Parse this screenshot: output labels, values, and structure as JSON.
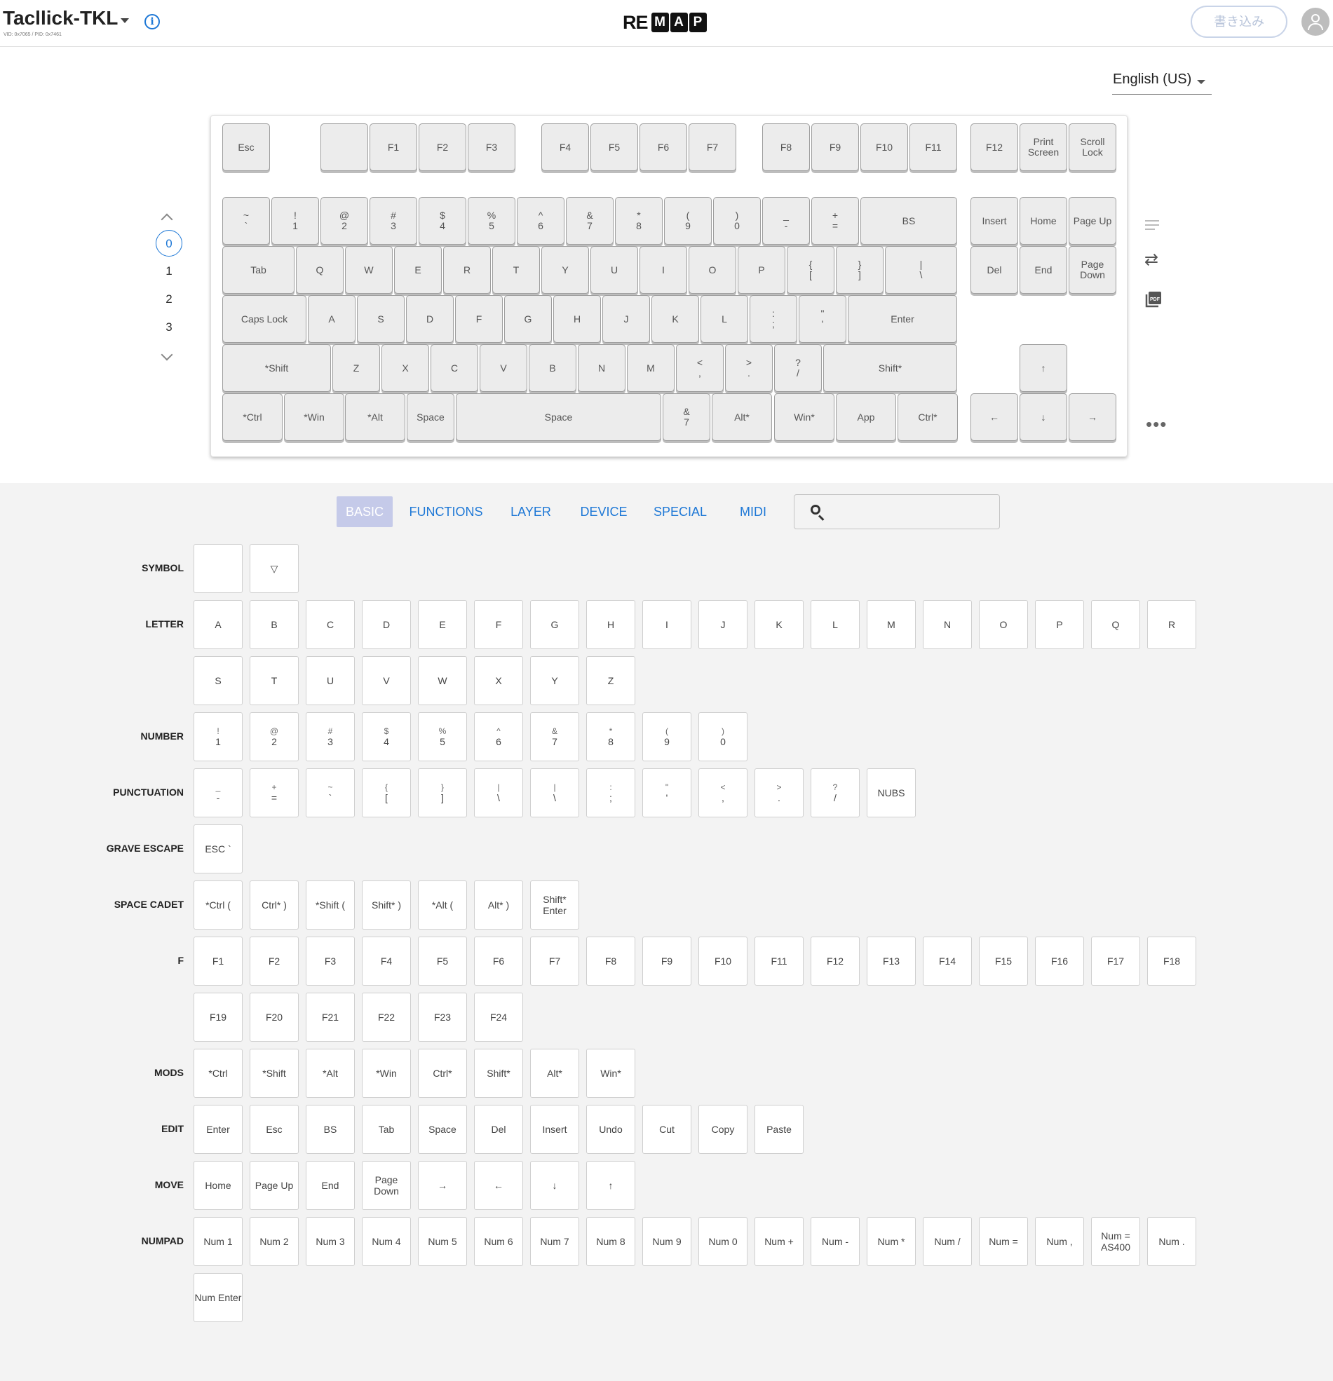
{
  "header": {
    "keyboard_name": "Tacllick-TKL",
    "ids": "VID: 0x7065 / PID: 0x7461",
    "logo_re": "RE",
    "logo_letters": [
      "M",
      "A",
      "P"
    ],
    "write_button": "書き込み"
  },
  "language": {
    "selected": "English (US)"
  },
  "layers": {
    "items": [
      "0",
      "1",
      "2",
      "3"
    ],
    "active": 0
  },
  "keyboard": {
    "rows": [
      [
        {
          "l": "Esc"
        },
        {
          "l": ""
        },
        {
          "l": "F1"
        },
        {
          "l": "F2"
        },
        {
          "l": "F3"
        },
        {
          "l": "F4"
        },
        {
          "l": "F5"
        },
        {
          "l": "F6"
        },
        {
          "l": "F7"
        },
        {
          "l": "F8"
        },
        {
          "l": "F9"
        },
        {
          "l": "F10"
        },
        {
          "l": "F11"
        },
        {
          "l": "F12"
        },
        {
          "l": "Print Screen"
        },
        {
          "l": "Scroll Lock"
        }
      ],
      [
        {
          "t": "~",
          "l": "`"
        },
        {
          "t": "!",
          "l": "1"
        },
        {
          "t": "@",
          "l": "2"
        },
        {
          "t": "#",
          "l": "3"
        },
        {
          "t": "$",
          "l": "4"
        },
        {
          "t": "%",
          "l": "5"
        },
        {
          "t": "^",
          "l": "6"
        },
        {
          "t": "&",
          "l": "7"
        },
        {
          "t": "*",
          "l": "8"
        },
        {
          "t": "(",
          "l": "9"
        },
        {
          "t": ")",
          "l": "0"
        },
        {
          "t": "_",
          "l": "-"
        },
        {
          "t": "+",
          "l": "="
        },
        {
          "l": "BS"
        },
        {
          "l": "Insert"
        },
        {
          "l": "Home"
        },
        {
          "l": "Page Up"
        }
      ],
      [
        {
          "l": "Tab"
        },
        {
          "l": "Q"
        },
        {
          "l": "W"
        },
        {
          "l": "E"
        },
        {
          "l": "R"
        },
        {
          "l": "T"
        },
        {
          "l": "Y"
        },
        {
          "l": "U"
        },
        {
          "l": "I"
        },
        {
          "l": "O"
        },
        {
          "l": "P"
        },
        {
          "t": "{",
          "l": "["
        },
        {
          "t": "}",
          "l": "]"
        },
        {
          "t": "|",
          "l": "\\"
        },
        {
          "l": "Del"
        },
        {
          "l": "End"
        },
        {
          "l": "Page Down"
        }
      ],
      [
        {
          "l": "Caps Lock"
        },
        {
          "l": "A"
        },
        {
          "l": "S"
        },
        {
          "l": "D"
        },
        {
          "l": "F"
        },
        {
          "l": "G"
        },
        {
          "l": "H"
        },
        {
          "l": "J"
        },
        {
          "l": "K"
        },
        {
          "l": "L"
        },
        {
          "t": ":",
          "l": ";"
        },
        {
          "t": "\"",
          "l": "'"
        },
        {
          "l": "Enter"
        }
      ],
      [
        {
          "l": "*Shift"
        },
        {
          "l": "Z"
        },
        {
          "l": "X"
        },
        {
          "l": "C"
        },
        {
          "l": "V"
        },
        {
          "l": "B"
        },
        {
          "l": "N"
        },
        {
          "l": "M"
        },
        {
          "t": "<",
          "l": ","
        },
        {
          "t": ">",
          "l": "."
        },
        {
          "t": "?",
          "l": "/"
        },
        {
          "l": "Shift*"
        },
        {
          "l": "↑"
        }
      ],
      [
        {
          "l": "*Ctrl"
        },
        {
          "l": "*Win"
        },
        {
          "l": "*Alt"
        },
        {
          "l": "Space"
        },
        {
          "l": "Space"
        },
        {
          "t": "&",
          "l": "7"
        },
        {
          "l": "Alt*"
        },
        {
          "l": "Win*"
        },
        {
          "l": "App"
        },
        {
          "l": "Ctrl*"
        },
        {
          "l": "←"
        },
        {
          "l": "↓"
        },
        {
          "l": "→"
        }
      ]
    ]
  },
  "side_icons": [
    "lines-icon",
    "swap-icon",
    "pdf-icon",
    "more-icon"
  ],
  "tabs": [
    {
      "label": "BASIC",
      "active": true
    },
    {
      "label": "FUNCTIONS",
      "active": false
    },
    {
      "label": "LAYER",
      "active": false
    },
    {
      "label": "DEVICE",
      "active": false
    },
    {
      "label": "SPECIAL",
      "active": false
    },
    {
      "label": "MIDI",
      "active": false
    }
  ],
  "search": {
    "placeholder": ""
  },
  "palette": [
    {
      "label": "SYMBOL",
      "rows": [
        [
          {
            "l": ""
          },
          {
            "l": "▽"
          }
        ]
      ]
    },
    {
      "label": "LETTER",
      "rows": [
        [
          {
            "l": "A"
          },
          {
            "l": "B"
          },
          {
            "l": "C"
          },
          {
            "l": "D"
          },
          {
            "l": "E"
          },
          {
            "l": "F"
          },
          {
            "l": "G"
          },
          {
            "l": "H"
          },
          {
            "l": "I"
          },
          {
            "l": "J"
          },
          {
            "l": "K"
          },
          {
            "l": "L"
          },
          {
            "l": "M"
          },
          {
            "l": "N"
          },
          {
            "l": "O"
          },
          {
            "l": "P"
          },
          {
            "l": "Q"
          },
          {
            "l": "R"
          }
        ],
        [
          {
            "l": "S"
          },
          {
            "l": "T"
          },
          {
            "l": "U"
          },
          {
            "l": "V"
          },
          {
            "l": "W"
          },
          {
            "l": "X"
          },
          {
            "l": "Y"
          },
          {
            "l": "Z"
          }
        ]
      ]
    },
    {
      "label": "NUMBER",
      "rows": [
        [
          {
            "t": "!",
            "l": "1"
          },
          {
            "t": "@",
            "l": "2"
          },
          {
            "t": "#",
            "l": "3"
          },
          {
            "t": "$",
            "l": "4"
          },
          {
            "t": "%",
            "l": "5"
          },
          {
            "t": "^",
            "l": "6"
          },
          {
            "t": "&",
            "l": "7"
          },
          {
            "t": "*",
            "l": "8"
          },
          {
            "t": "(",
            "l": "9"
          },
          {
            "t": ")",
            "l": "0"
          }
        ]
      ]
    },
    {
      "label": "PUNCTUATION",
      "rows": [
        [
          {
            "t": "_",
            "l": "-"
          },
          {
            "t": "+",
            "l": "="
          },
          {
            "t": "~",
            "l": "`"
          },
          {
            "t": "{",
            "l": "["
          },
          {
            "t": "}",
            "l": "]"
          },
          {
            "t": "|",
            "l": "\\"
          },
          {
            "t": "|",
            "l": "\\"
          },
          {
            "t": ":",
            "l": ";"
          },
          {
            "t": "\"",
            "l": "'"
          },
          {
            "t": "<",
            "l": ","
          },
          {
            "t": ">",
            "l": "."
          },
          {
            "t": "?",
            "l": "/"
          },
          {
            "l": "NUBS"
          }
        ]
      ]
    },
    {
      "label": "GRAVE ESCAPE",
      "rows": [
        [
          {
            "l": "ESC `"
          }
        ]
      ]
    },
    {
      "label": "SPACE CADET",
      "rows": [
        [
          {
            "l": "*Ctrl ("
          },
          {
            "l": "Ctrl* )"
          },
          {
            "l": "*Shift ("
          },
          {
            "l": "Shift* )"
          },
          {
            "l": "*Alt ("
          },
          {
            "l": "Alt* )"
          },
          {
            "l": "Shift* Enter"
          }
        ]
      ]
    },
    {
      "label": "F",
      "rows": [
        [
          {
            "l": "F1"
          },
          {
            "l": "F2"
          },
          {
            "l": "F3"
          },
          {
            "l": "F4"
          },
          {
            "l": "F5"
          },
          {
            "l": "F6"
          },
          {
            "l": "F7"
          },
          {
            "l": "F8"
          },
          {
            "l": "F9"
          },
          {
            "l": "F10"
          },
          {
            "l": "F11"
          },
          {
            "l": "F12"
          },
          {
            "l": "F13"
          },
          {
            "l": "F14"
          },
          {
            "l": "F15"
          },
          {
            "l": "F16"
          },
          {
            "l": "F17"
          },
          {
            "l": "F18"
          }
        ],
        [
          {
            "l": "F19"
          },
          {
            "l": "F20"
          },
          {
            "l": "F21"
          },
          {
            "l": "F22"
          },
          {
            "l": "F23"
          },
          {
            "l": "F24"
          }
        ]
      ]
    },
    {
      "label": "MODS",
      "rows": [
        [
          {
            "l": "*Ctrl"
          },
          {
            "l": "*Shift"
          },
          {
            "l": "*Alt"
          },
          {
            "l": "*Win"
          },
          {
            "l": "Ctrl*"
          },
          {
            "l": "Shift*"
          },
          {
            "l": "Alt*"
          },
          {
            "l": "Win*"
          }
        ]
      ]
    },
    {
      "label": "EDIT",
      "rows": [
        [
          {
            "l": "Enter"
          },
          {
            "l": "Esc"
          },
          {
            "l": "BS"
          },
          {
            "l": "Tab"
          },
          {
            "l": "Space"
          },
          {
            "l": "Del"
          },
          {
            "l": "Insert"
          },
          {
            "l": "Undo"
          },
          {
            "l": "Cut"
          },
          {
            "l": "Copy"
          },
          {
            "l": "Paste"
          }
        ]
      ]
    },
    {
      "label": "MOVE",
      "rows": [
        [
          {
            "l": "Home"
          },
          {
            "l": "Page Up"
          },
          {
            "l": "End"
          },
          {
            "l": "Page Down"
          },
          {
            "l": "→"
          },
          {
            "l": "←"
          },
          {
            "l": "↓"
          },
          {
            "l": "↑"
          }
        ]
      ]
    },
    {
      "label": "NUMPAD",
      "rows": [
        [
          {
            "l": "Num 1"
          },
          {
            "l": "Num 2"
          },
          {
            "l": "Num 3"
          },
          {
            "l": "Num 4"
          },
          {
            "l": "Num 5"
          },
          {
            "l": "Num 6"
          },
          {
            "l": "Num 7"
          },
          {
            "l": "Num 8"
          },
          {
            "l": "Num 9"
          },
          {
            "l": "Num 0"
          },
          {
            "l": "Num +"
          },
          {
            "l": "Num -"
          },
          {
            "l": "Num *"
          },
          {
            "l": "Num /"
          },
          {
            "l": "Num ="
          },
          {
            "l": "Num ,"
          },
          {
            "l": "Num = AS400"
          },
          {
            "l": "Num ."
          }
        ],
        [
          {
            "l": "Num Enter"
          }
        ]
      ]
    }
  ]
}
